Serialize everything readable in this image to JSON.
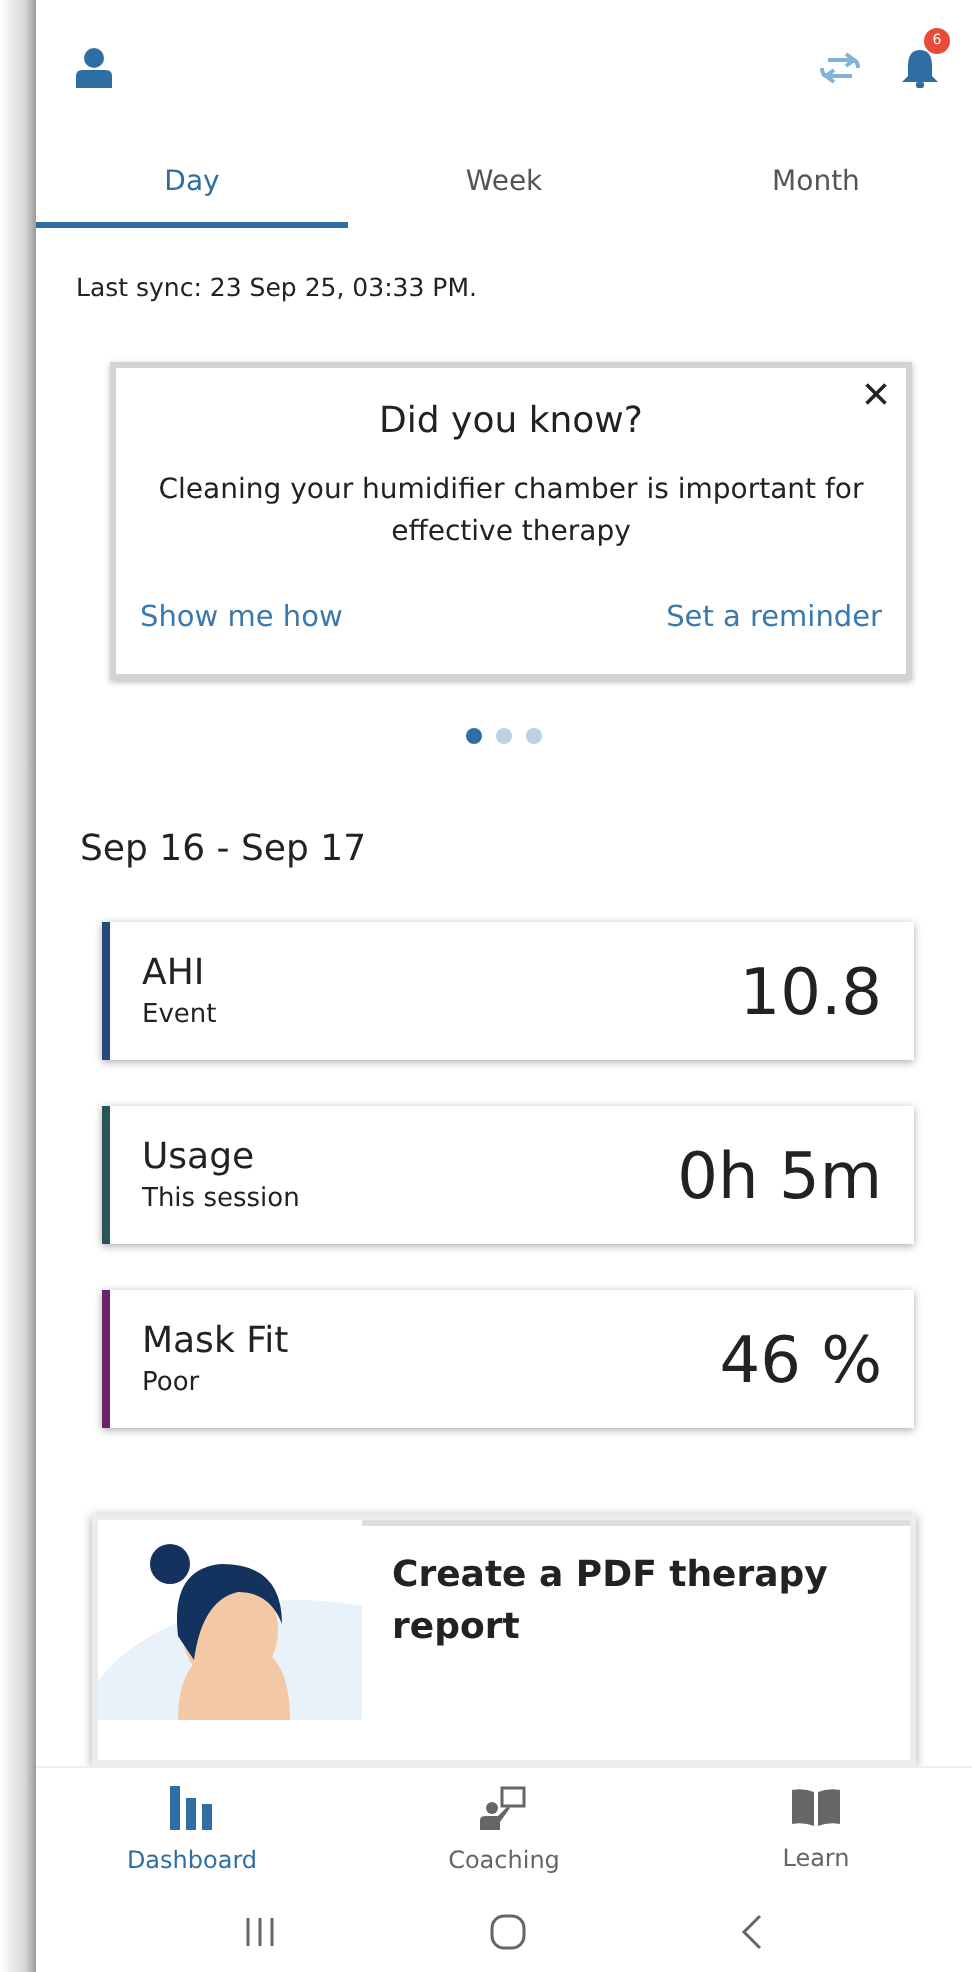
{
  "header": {
    "notification_count": "6"
  },
  "tabs": [
    {
      "label": "Day",
      "selected": true
    },
    {
      "label": "Week",
      "selected": false
    },
    {
      "label": "Month",
      "selected": false
    }
  ],
  "last_sync": "Last sync: 23 Sep 25, 03:33 PM.",
  "tip_card": {
    "close": "×",
    "title": "Did you know?",
    "body": "Cleaning your humidifier chamber is important for effective therapy",
    "actions": [
      "Show me how",
      "Set a reminder"
    ]
  },
  "carousel_dots": [
    {
      "selected": true
    },
    {
      "selected": false
    },
    {
      "selected": false
    }
  ],
  "date_range": "Sep 16 - Sep 17",
  "metrics": [
    {
      "name": "AHI",
      "sub": "Event",
      "value": "10.8",
      "color": "#27497a"
    },
    {
      "name": "Usage",
      "sub": "This session",
      "value": "0h 5m",
      "color": "#2a5556"
    },
    {
      "name": "Mask Fit",
      "sub": "Poor",
      "value": "46 %",
      "color": "#6a2468"
    }
  ],
  "promo": {
    "title": "Create a PDF therapy report"
  },
  "nav": [
    {
      "kind": "dashboard",
      "label": "Dashboard",
      "selected": true
    },
    {
      "kind": "coaching",
      "label": "Coaching",
      "selected": false
    },
    {
      "kind": "learn",
      "label": "Learn",
      "selected": false
    }
  ]
}
